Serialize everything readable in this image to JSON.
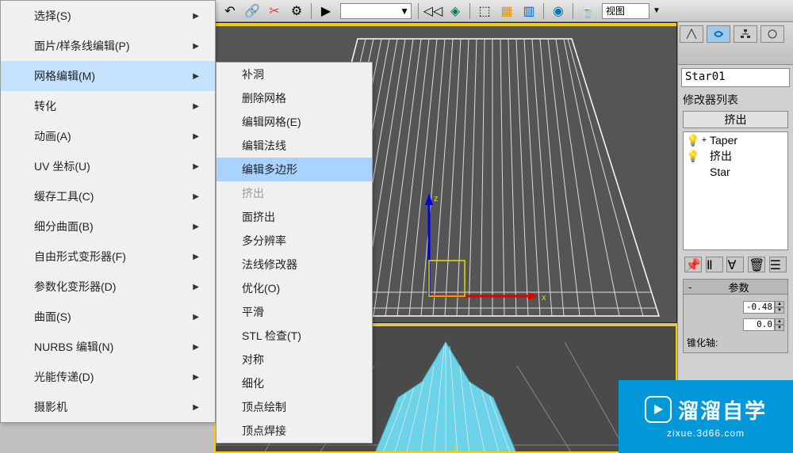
{
  "toolbar": {
    "view_label": "视图"
  },
  "menu": {
    "items": [
      {
        "label": "选择(S)",
        "has_children": true,
        "highlighted": false
      },
      {
        "label": "面片/样条线编辑(P)",
        "has_children": true,
        "highlighted": false
      },
      {
        "label": "网格编辑(M)",
        "has_children": true,
        "highlighted": true
      },
      {
        "label": "转化",
        "has_children": true,
        "highlighted": false
      },
      {
        "label": "动画(A)",
        "has_children": true,
        "highlighted": false
      },
      {
        "label": "UV 坐标(U)",
        "has_children": true,
        "highlighted": false
      },
      {
        "label": "缓存工具(C)",
        "has_children": true,
        "highlighted": false
      },
      {
        "label": "细分曲面(B)",
        "has_children": true,
        "highlighted": false
      },
      {
        "label": "自由形式变形器(F)",
        "has_children": true,
        "highlighted": false
      },
      {
        "label": "参数化变形器(D)",
        "has_children": true,
        "highlighted": false
      },
      {
        "label": "曲面(S)",
        "has_children": true,
        "highlighted": false
      },
      {
        "label": "NURBS 编辑(N)",
        "has_children": true,
        "highlighted": false
      },
      {
        "label": "光能传递(D)",
        "has_children": true,
        "highlighted": false
      },
      {
        "label": "摄影机",
        "has_children": true,
        "highlighted": false
      }
    ]
  },
  "submenu": {
    "items": [
      {
        "label": "补洞",
        "highlighted": false,
        "disabled": false
      },
      {
        "label": "删除网格",
        "highlighted": false,
        "disabled": false
      },
      {
        "label": "编辑网格(E)",
        "highlighted": false,
        "disabled": false
      },
      {
        "label": "编辑法线",
        "highlighted": false,
        "disabled": false
      },
      {
        "label": "编辑多边形",
        "highlighted": true,
        "disabled": false
      },
      {
        "label": "挤出",
        "highlighted": false,
        "disabled": true
      },
      {
        "label": "面挤出",
        "highlighted": false,
        "disabled": false
      },
      {
        "label": "多分辨率",
        "highlighted": false,
        "disabled": false
      },
      {
        "label": "法线修改器",
        "highlighted": false,
        "disabled": false
      },
      {
        "label": "优化(O)",
        "highlighted": false,
        "disabled": false
      },
      {
        "label": "平滑",
        "highlighted": false,
        "disabled": false
      },
      {
        "label": "STL 检查(T)",
        "highlighted": false,
        "disabled": false
      },
      {
        "label": "对称",
        "highlighted": false,
        "disabled": false
      },
      {
        "label": "细化",
        "highlighted": false,
        "disabled": false
      },
      {
        "label": "顶点绘制",
        "highlighted": false,
        "disabled": false
      },
      {
        "label": "顶点焊接",
        "highlighted": false,
        "disabled": false
      }
    ]
  },
  "panel": {
    "object_name": "Star01",
    "modifier_list_label": "修改器列表",
    "current_modifier": "挤出",
    "stack": [
      {
        "expand": "+",
        "label": "Taper"
      },
      {
        "expand": " ",
        "label": "挤出"
      },
      {
        "expand": " ",
        "label": "Star"
      }
    ],
    "rollup_title": "参数",
    "taper_axis_label": "锥化轴:",
    "spinner1": "-0.48",
    "spinner2": "0.0"
  },
  "watermark": {
    "title": "溜溜自学",
    "url": "zixue.3d66.com"
  }
}
